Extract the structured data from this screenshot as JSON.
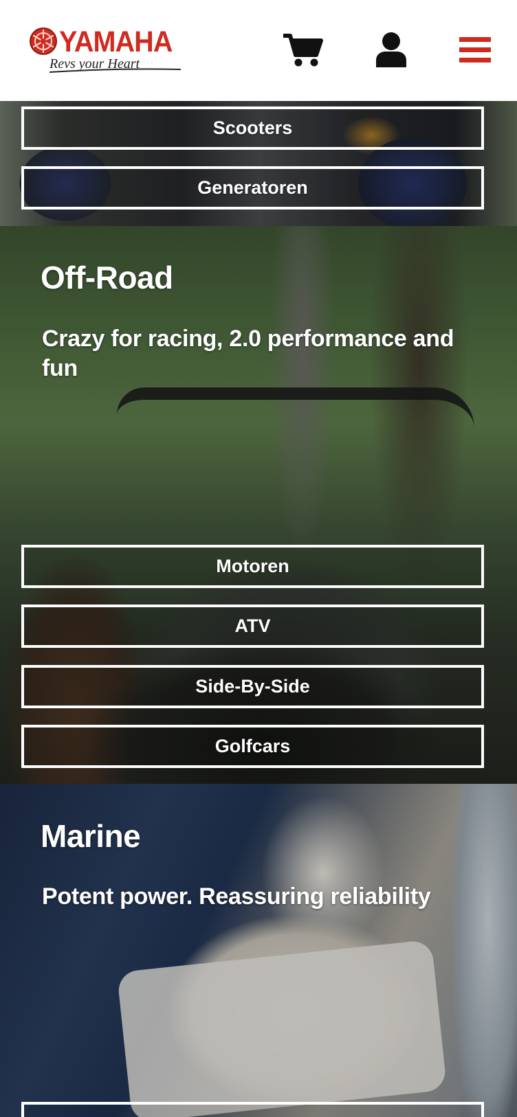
{
  "header": {
    "brand": "YAMAHA",
    "tagline": "Revs your Heart",
    "icons": [
      "yamaha-logo-icon",
      "cart-icon",
      "user-icon",
      "menu-icon"
    ],
    "brand_color": "#cf2a1f"
  },
  "sections": {
    "street": {
      "buttons": [
        "Scooters",
        "Generatoren"
      ]
    },
    "offroad": {
      "title": "Off-Road",
      "subtitle": "Crazy for racing, 2.0 performance and fun",
      "buttons": [
        "Motoren",
        "ATV",
        "Side-By-Side",
        "Golfcars"
      ]
    },
    "marine": {
      "title": "Marine",
      "subtitle": "Potent power. Reassuring reliability"
    }
  }
}
